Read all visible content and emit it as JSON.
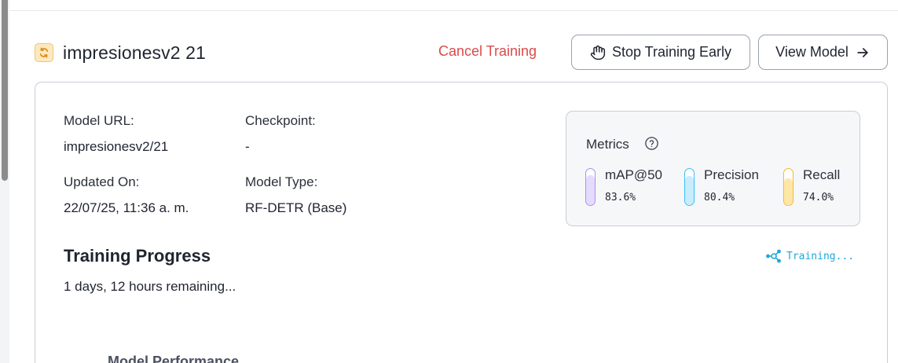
{
  "header": {
    "title": "impresionesv2 21",
    "cancel_label": "Cancel Training",
    "stop_label": "Stop Training Early",
    "view_label": "View Model"
  },
  "details": {
    "model_url_label": "Model URL:",
    "model_url_value": "impresionesv2/21",
    "checkpoint_label": "Checkpoint:",
    "checkpoint_value": "-",
    "updated_label": "Updated On:",
    "updated_value": "22/07/25, 11:36 a. m.",
    "type_label": "Model Type:",
    "type_value": "RF-DETR (Base)"
  },
  "metrics": {
    "title": "Metrics",
    "items": [
      {
        "name": "mAP@50",
        "value": "83.6%",
        "color": "#a78bfa",
        "fill": "#e5dcfd",
        "level": 0.836
      },
      {
        "name": "Precision",
        "value": "80.4%",
        "color": "#38bdf8",
        "fill": "#c8ecfb",
        "level": 0.804
      },
      {
        "name": "Recall",
        "value": "74.0%",
        "color": "#f5b82e",
        "fill": "#fde7a8",
        "level": 0.74
      }
    ]
  },
  "progress": {
    "title": "Training Progress",
    "remaining": "1 days, 12 hours remaining...",
    "status": "Training..."
  },
  "performance": {
    "title": "Model Performance"
  },
  "colors": {
    "danger": "#dc4a4a",
    "accent": "#1fa8d8"
  }
}
